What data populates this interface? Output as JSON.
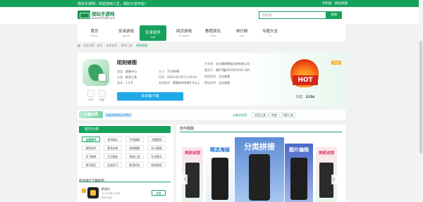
{
  "topbar": {
    "welcome": "我玩手游网：体验游戏人生，做好分享开始！",
    "links": [
      "手机版",
      "网站地图"
    ]
  },
  "header": {
    "logo_name": "我玩手游网",
    "logo_url": "www.wr148.com",
    "search_placeholder": "手机游",
    "search_button": "搜索"
  },
  "nav": [
    {
      "label": "首页",
      "sub": "home"
    },
    {
      "label": "安卓游戏",
      "sub": "game"
    },
    {
      "label": "安卓软件",
      "sub": "soft"
    },
    {
      "label": "网页游戏",
      "sub": "h5 game"
    },
    {
      "label": "教程资讯",
      "sub": "news"
    },
    {
      "label": "排行榜",
      "sub": "top"
    },
    {
      "label": "专题大全",
      "sub": "zt"
    }
  ],
  "breadcrumb": [
    "当前位置：首页",
    "安卓软件",
    "影音工具",
    "陌刻修图"
  ],
  "app": {
    "title": "陌刻修图",
    "type_label": "类型：",
    "type_value": "图像中心",
    "size_label": "大小：",
    "size_value": "75.80MB",
    "cat_label": "分类：",
    "cat_value": "影音工具",
    "time_label": "时间：",
    "time_value": "2025-02-05 11:05:01",
    "ver_label": "版本：",
    "ver_value": "1.3.0",
    "sys_label": "系统要求：",
    "sys_value": "需要安卓系统5.0以上",
    "dev_label": "开发商：",
    "dev_value": "长沙精昂数据信息有限公司",
    "record_label": "备案号：",
    "record_value": "湘ICP备20230120号-16A",
    "perm_label": "权限说明：",
    "perm_value": "点击查看",
    "priv_label": "隐私说明：",
    "priv_value": "点击查看",
    "download_button": "安卓版下载",
    "share_labels": [
      "分享",
      "收藏"
    ],
    "hot_text": "HOT",
    "hot_badge": "手游",
    "heat_label": "热度：",
    "heat_value": "2154"
  },
  "strip": {
    "logo_text": "小编点评",
    "tag": "海量原图精彩免费用",
    "keyword_label": "关键字标签：",
    "tags": [
      "实用工具",
      "特效",
      "万能工具"
    ]
  },
  "left_panel": {
    "title": "软件分类",
    "categories": [
      [
        "全部软件",
        "休闲娱乐",
        "手游辅助",
        "主题壁纸"
      ],
      [
        "理财软件",
        "影音安装",
        "拍照摄影",
        "办公管理"
      ],
      [
        "学习教育",
        "生活服务",
        "系统工具",
        "社交聊天"
      ],
      [
        "悦乐购买",
        "阅读学习",
        "影音综合",
        "新闻阅读"
      ]
    ],
    "rank_title": "软件排行下载榜单",
    "rank_item": {
      "num": "1",
      "name": "影游仿",
      "meta": "34.20MB/25MB",
      "meta2": "类型 游戏",
      "button": "查看"
    }
  },
  "right_panel": {
    "title": "软件截图",
    "screens": [
      {
        "title": "美颜滤镜"
      },
      {
        "title": "精选海报"
      },
      {
        "title": "分类拼接"
      },
      {
        "title": "图片编辑"
      },
      {
        "title": "美颜滤镜"
      }
    ]
  }
}
